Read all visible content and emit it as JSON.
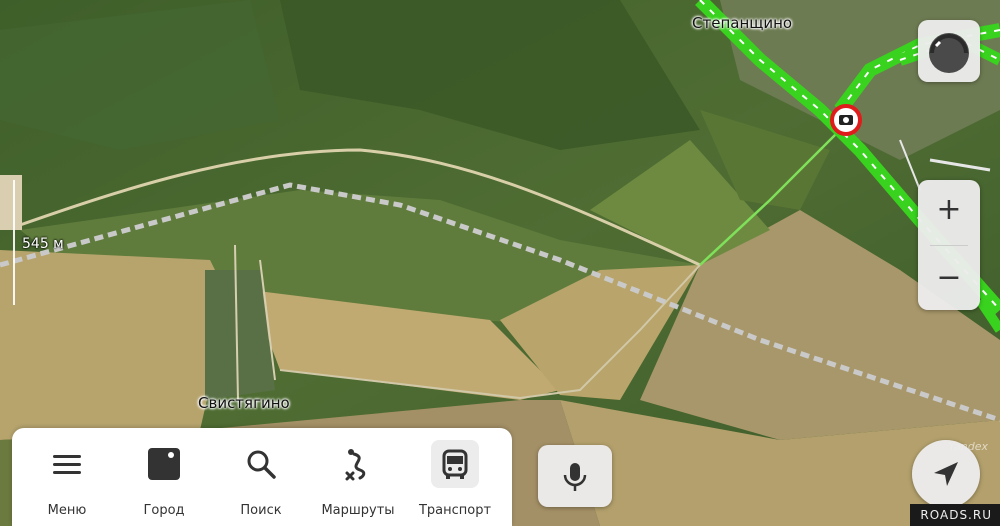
{
  "map": {
    "places": {
      "village_north": "Степанщино",
      "village_south": "Свистягино"
    },
    "scale_label": "545 м",
    "provider_mark": "Yandex"
  },
  "controls": {
    "zoom_in_label": "+",
    "zoom_out_label": "−"
  },
  "bottom_nav": {
    "items": [
      {
        "label": "Меню",
        "icon": "menu-icon"
      },
      {
        "label": "Город",
        "icon": "city-icon"
      },
      {
        "label": "Поиск",
        "icon": "search-icon"
      },
      {
        "label": "Маршруты",
        "icon": "routes-icon"
      },
      {
        "label": "Транспорт",
        "icon": "bus-icon",
        "active": true
      }
    ]
  },
  "watermark": "ROADS.RU",
  "colors": {
    "route_green": "#39d21e",
    "camera_red": "#e01b1b",
    "field_tan": "#b8a56c"
  }
}
